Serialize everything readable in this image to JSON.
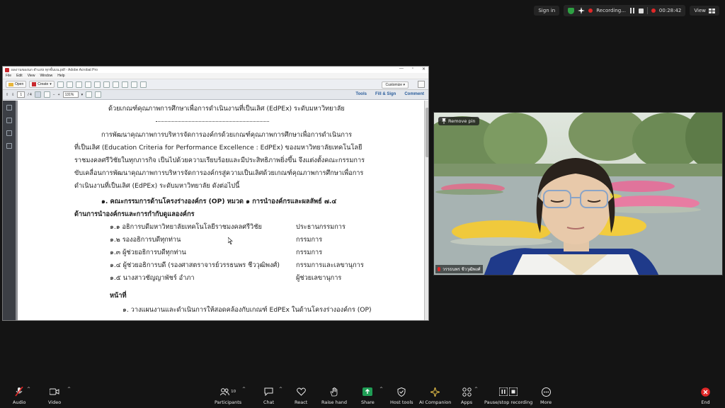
{
  "topbar": {
    "sign_in": "Sign in",
    "recording": "Recording...",
    "timer": "00:28:42",
    "view": "View"
  },
  "acrobat": {
    "title": "ผลงานของนก ตำแห่ง ทุกชั้นบน.pdf - Adobe Acrobat Pro",
    "menu": [
      "File",
      "Edit",
      "View",
      "Window",
      "Help"
    ],
    "toolbar": {
      "open": "Open",
      "create": "Create",
      "customize": "Customize"
    },
    "nav": {
      "page_current": "1",
      "page_total": "/ 4",
      "zoom": "131%"
    },
    "tabs": [
      "Tools",
      "Fill & Sign",
      "Comment"
    ]
  },
  "document": {
    "heading": "ด้วยเกณฑ์คุณภาพการศึกษาเพื่อการดำเนินงานที่เป็นเลิศ (EdPEx) ระดับมหาวิทยาลัย",
    "para": [
      "การพัฒนาคุณภาพการบริหารจัดการองค์กรด้วยเกณฑ์คุณภาพการศึกษาเพื่อการดำเนินการ",
      "ที่เป็นเลิศ (Education Criteria for Performance Excellence : EdPEx) ของมหาวิทยาลัยเทคโนโลยี",
      "ราชมงคลศรีวิชัยในทุกภารกิจ เป็นไปด้วยความเรียบร้อยและมีประสิทธิภาพยิ่งขึ้น จึงแต่งตั้งคณะกรรมการ",
      "ขับเคลื่อนการพัฒนาคุณภาพการบริหารจัดการองค์กรสู่ความเป็นเลิศด้วยเกณฑ์คุณภาพการศึกษาเพื่อการ",
      "ดำเนินงานที่เป็นเลิศ (EdPEx) ระดับมหาวิทยาลัย ดังต่อไปนี้"
    ],
    "section_title": "๑. คณะกรรมการด้านโครงร่างองค์กร (OP) หมวด ๑ การนำองค์กรและผลลัพธ์ ๗.๔",
    "section_sub": "ด้านการนำองค์กรและการกำกับดูแลองค์กร",
    "members": [
      {
        "name": "๑.๑ อธิการบดีมหาวิทยาลัยเทคโนโลยีราชมงคลศรีวิชัย",
        "role": "ประธานกรรมการ"
      },
      {
        "name": "๑.๒ รองอธิการบดีทุกท่าน",
        "role": "กรรมการ"
      },
      {
        "name": "๑.๓ ผู้ช่วยอธิการบดีทุกท่าน",
        "role": "กรรมการ"
      },
      {
        "name": "๑.๔ ผู้ช่วยอธิการบดี (รองศาสตราจารย์วรรธนพร ชีววุฒิพงศ์)",
        "role": "กรรมการและเลขานุการ"
      },
      {
        "name": "๑.๕ นางสาวชัญญาพัชร์ อำภา",
        "role": "ผู้ช่วยเลขานุการ"
      }
    ],
    "duty_title": "หน้าที่",
    "duty_1": "๑. วางแผนงานและดำเนินการให้สอดคล้องกับเกณฑ์ EdPEx ในด้านโครงร่างองค์กร (OP)"
  },
  "video": {
    "remove_pin": "Remove pin",
    "participant_name": "วรรธนพร ชีววุฒิพงศ์"
  },
  "bottombar": {
    "audio": "Audio",
    "video": "Video",
    "participants": "Participants",
    "participants_count": "10",
    "chat": "Chat",
    "react": "React",
    "raise_hand": "Raise hand",
    "share": "Share",
    "host_tools": "Host tools",
    "ai_companion": "AI Companion",
    "apps": "Apps",
    "pause_stop": "Pause/stop recording",
    "more": "More",
    "end": "End"
  },
  "colors": {
    "share_green": "#1f9d55",
    "end_red": "#e02828",
    "acrobat_tab_blue": "#2a5d9b"
  }
}
